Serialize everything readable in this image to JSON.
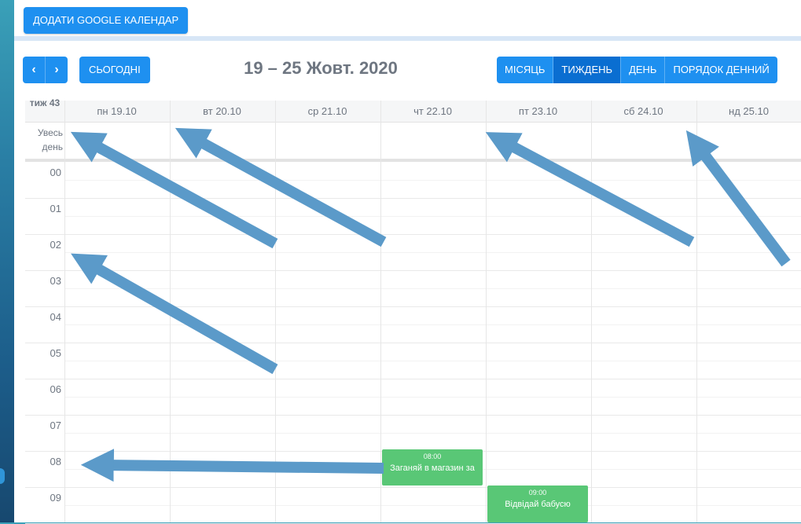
{
  "topbar": {
    "google_calendar_button": "ДОДАТИ GOOGLE КАЛЕНДАР"
  },
  "toolbar": {
    "prev_icon": "chevron-left",
    "next_icon": "chevron-right",
    "today_label": "СЬОГОДНІ",
    "title": "19 – 25 Жовт. 2020",
    "views": [
      {
        "label": "МІСЯЦЬ",
        "active": false
      },
      {
        "label": "ТИЖДЕНЬ",
        "active": true
      },
      {
        "label": "ДЕНЬ",
        "active": false
      },
      {
        "label": "ПОРЯДОК ДЕННИЙ",
        "active": false
      }
    ]
  },
  "grid": {
    "week_label": "тиж 43",
    "all_day_label": "Увесь день",
    "days": [
      "пн 19.10",
      "вт 20.10",
      "ср 21.10",
      "чт 22.10",
      "пт 23.10",
      "сб 24.10",
      "нд 25.10"
    ],
    "hours": [
      "00",
      "01",
      "02",
      "03",
      "04",
      "05",
      "06",
      "07",
      "08",
      "09"
    ]
  },
  "events": [
    {
      "time": "08:00",
      "title": "Заганяй в магазин за",
      "day": "чт 22.10"
    },
    {
      "time": "09:00",
      "title": "Відвідай бабусю",
      "day": "пт 23.10"
    }
  ],
  "colors": {
    "accent": "#1e90f0",
    "active": "#0a6ed1",
    "event": "#59c776",
    "arrow": "#5b9ac9"
  }
}
